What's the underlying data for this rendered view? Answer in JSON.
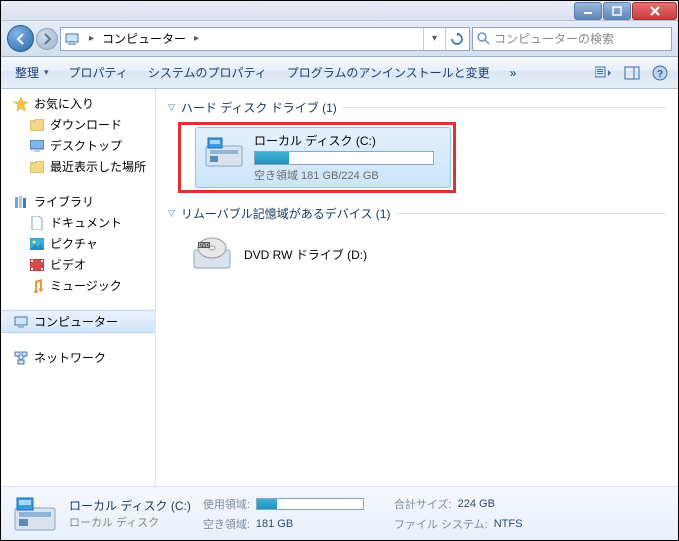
{
  "titlebar": {
    "min": "—",
    "max": "◻",
    "close": "✕"
  },
  "address": {
    "location": "コンピューター",
    "chevron": "▸",
    "search_placeholder": "コンピューターの検索"
  },
  "toolbar": {
    "organize": "整理",
    "properties": "プロパティ",
    "sysproperties": "システムのプロパティ",
    "uninstall": "プログラムのアンインストールと変更",
    "more": "»"
  },
  "sidebar": {
    "favorites": "お気に入り",
    "favorites_items": [
      "ダウンロード",
      "デスクトップ",
      "最近表示した場所"
    ],
    "libraries": "ライブラリ",
    "libraries_items": [
      "ドキュメント",
      "ピクチャ",
      "ビデオ",
      "ミュージック"
    ],
    "computer": "コンピューター",
    "network": "ネットワーク"
  },
  "groups": {
    "hdd": "ハード ディスク ドライブ (1)",
    "removable": "リムーバブル記憶域があるデバイス (1)"
  },
  "drives": {
    "c": {
      "name": "ローカル ディスク (C:)",
      "freeline": "空き領域 181 GB/224 GB",
      "fill_percent": 19
    },
    "dvd": {
      "name": "DVD RW ドライブ (D:)"
    }
  },
  "details": {
    "title": "ローカル ディスク (C:)",
    "subtitle": "ローカル ディスク",
    "used_label": "使用領域:",
    "free_label": "空き領域:",
    "free_value": "181 GB",
    "total_label": "合計サイズ:",
    "total_value": "224 GB",
    "fs_label": "ファイル システム:",
    "fs_value": "NTFS",
    "fill_percent": 19
  }
}
